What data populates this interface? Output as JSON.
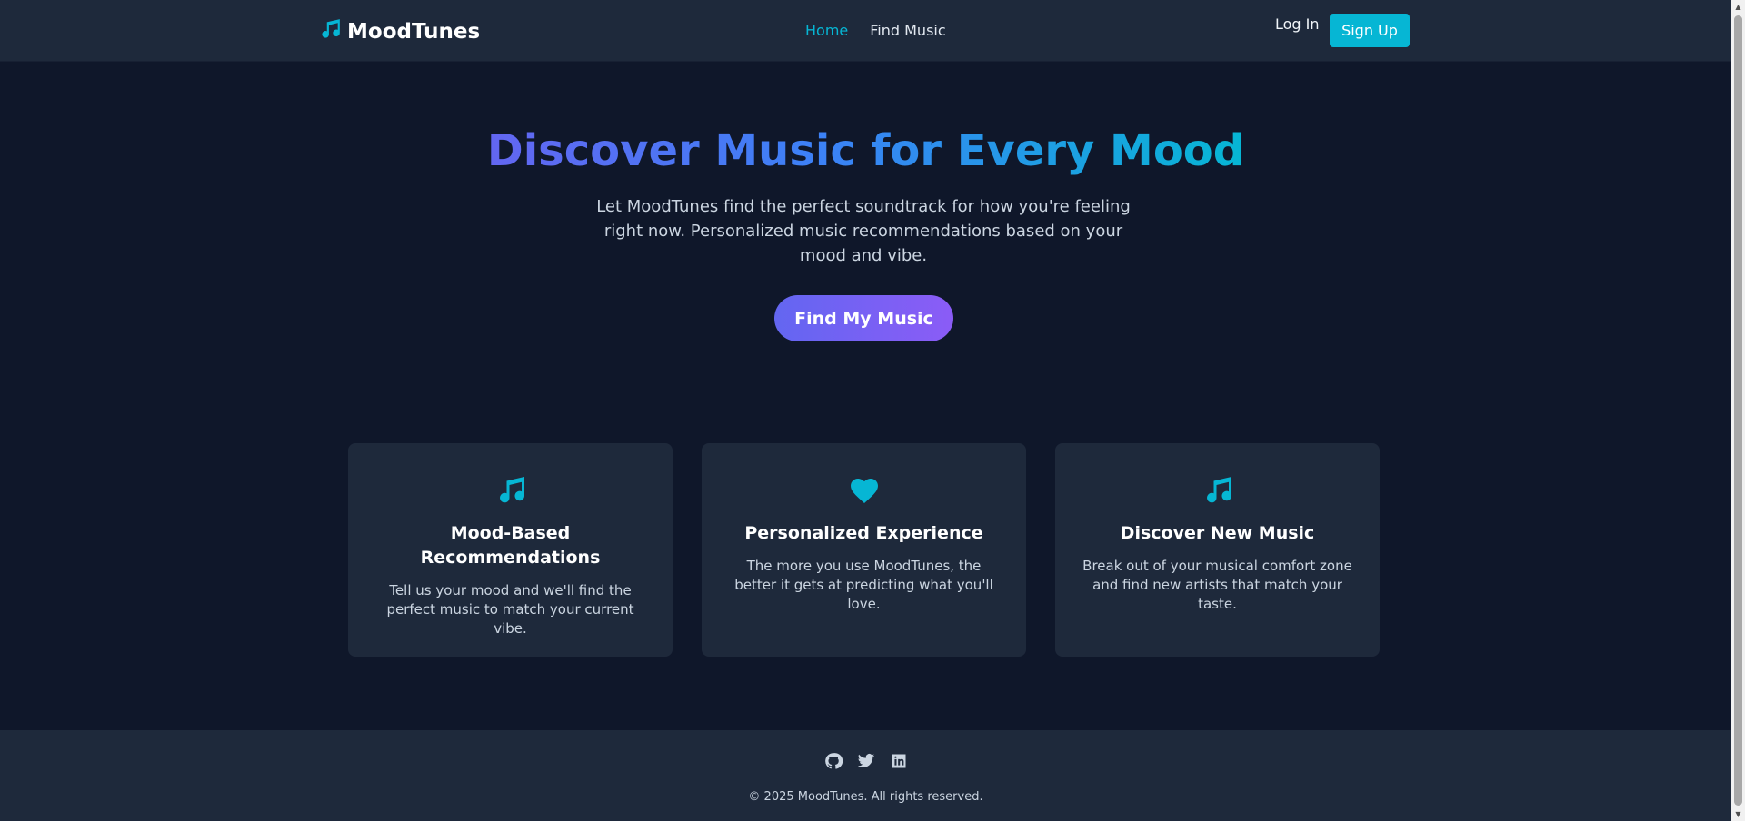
{
  "navbar": {
    "brand": "MoodTunes",
    "brand_icon": "music-note-icon",
    "links": [
      {
        "label": "Home",
        "active": true
      },
      {
        "label": "Find Music",
        "active": false
      }
    ],
    "login_label": "Log In",
    "signup_label": "Sign Up"
  },
  "hero": {
    "title": "Discover Music for Every Mood",
    "subtitle": "Let MoodTunes find the perfect soundtrack for how you're feeling right now. Personalized music recommendations based on your mood and vibe.",
    "cta_label": "Find My Music"
  },
  "features": [
    {
      "icon": "music-note-icon",
      "title": "Mood-Based Recommendations",
      "text": "Tell us your mood and we'll find the perfect music to match your current vibe."
    },
    {
      "icon": "heart-icon",
      "title": "Personalized Experience",
      "text": "The more you use MoodTunes, the better it gets at predicting what you'll love."
    },
    {
      "icon": "music-note-icon",
      "title": "Discover New Music",
      "text": "Break out of your musical comfort zone and find new artists that match your taste."
    }
  ],
  "footer": {
    "social_icons": [
      "github-icon",
      "twitter-icon",
      "linkedin-icon"
    ],
    "copyright": "© 2025 MoodTunes. All rights reserved."
  },
  "colors": {
    "background": "#0f172a",
    "surface": "#1e293b",
    "accent": "#06b6d4",
    "gradient_start": "#6366f1",
    "gradient_end": "#8b5cf6"
  }
}
